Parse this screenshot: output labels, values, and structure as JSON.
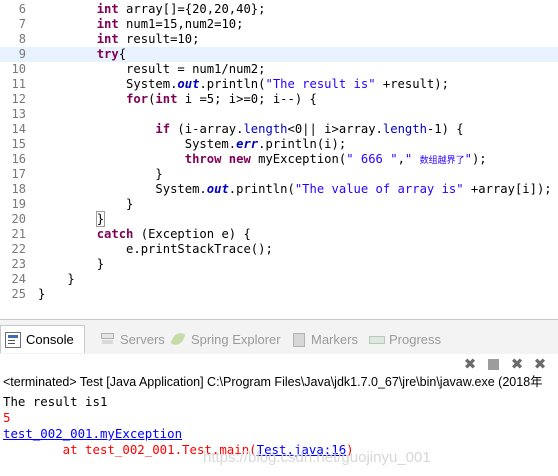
{
  "editor": {
    "lines": [
      {
        "n": "6",
        "parts": [
          [
            "p",
            "        "
          ],
          [
            "k",
            "int"
          ],
          [
            "p",
            " array[]={20,20,40};"
          ]
        ]
      },
      {
        "n": "7",
        "parts": [
          [
            "p",
            "        "
          ],
          [
            "k",
            "int"
          ],
          [
            "p",
            " num1=15,num2=10;"
          ]
        ]
      },
      {
        "n": "8",
        "parts": [
          [
            "p",
            "        "
          ],
          [
            "k",
            "int"
          ],
          [
            "p",
            " result=10;"
          ]
        ]
      },
      {
        "n": "9",
        "parts": [
          [
            "p",
            "        "
          ],
          [
            "k",
            "try"
          ],
          [
            "p",
            "{"
          ]
        ],
        "highlight": true
      },
      {
        "n": "10",
        "parts": [
          [
            "p",
            "            result = num1/num2;"
          ]
        ]
      },
      {
        "n": "11",
        "parts": [
          [
            "p",
            "            System."
          ],
          [
            "f",
            "out"
          ],
          [
            "p",
            ".println("
          ],
          [
            "s",
            "\"The result is\""
          ],
          [
            "p",
            " +result);"
          ]
        ]
      },
      {
        "n": "12",
        "parts": [
          [
            "p",
            "            "
          ],
          [
            "k",
            "for"
          ],
          [
            "p",
            "("
          ],
          [
            "k",
            "int"
          ],
          [
            "p",
            " i =5; i>=0; i--) {"
          ]
        ]
      },
      {
        "n": "13",
        "parts": [
          [
            "p",
            ""
          ]
        ]
      },
      {
        "n": "14",
        "parts": [
          [
            "p",
            "                "
          ],
          [
            "k",
            "if"
          ],
          [
            "p",
            " (i-array."
          ],
          [
            "fp",
            "length"
          ],
          [
            "p",
            "<0|| i>array."
          ],
          [
            "fp",
            "length"
          ],
          [
            "p",
            "-1) {"
          ]
        ]
      },
      {
        "n": "15",
        "parts": [
          [
            "p",
            "                    System."
          ],
          [
            "f",
            "err"
          ],
          [
            "p",
            ".println(i);"
          ]
        ]
      },
      {
        "n": "16",
        "parts": [
          [
            "p",
            "                    "
          ],
          [
            "k",
            "throw"
          ],
          [
            "p",
            " "
          ],
          [
            "k",
            "new"
          ],
          [
            "p",
            " myException("
          ],
          [
            "s",
            "\" 666 \""
          ],
          [
            "p",
            ","
          ],
          [
            "s",
            "\" "
          ],
          [
            "cjk",
            "数组越界了"
          ],
          [
            "s",
            "\""
          ],
          [
            "p",
            ");"
          ]
        ]
      },
      {
        "n": "17",
        "parts": [
          [
            "p",
            "                }"
          ]
        ]
      },
      {
        "n": "18",
        "parts": [
          [
            "p",
            "                System."
          ],
          [
            "f",
            "out"
          ],
          [
            "p",
            ".println("
          ],
          [
            "s",
            "\"The value of array is\""
          ],
          [
            "p",
            " +array[i]);"
          ]
        ]
      },
      {
        "n": "19",
        "parts": [
          [
            "p",
            "            }"
          ]
        ]
      },
      {
        "n": "20",
        "parts": [
          [
            "p",
            "        "
          ],
          [
            "box",
            "}"
          ]
        ]
      },
      {
        "n": "21",
        "parts": [
          [
            "p",
            "        "
          ],
          [
            "k",
            "catch"
          ],
          [
            "p",
            " (Exception e) {"
          ]
        ]
      },
      {
        "n": "22",
        "parts": [
          [
            "p",
            "            e.printStackTrace();"
          ]
        ]
      },
      {
        "n": "23",
        "parts": [
          [
            "p",
            "        }"
          ]
        ]
      },
      {
        "n": "24",
        "parts": [
          [
            "p",
            "    }"
          ]
        ]
      },
      {
        "n": "25",
        "parts": [
          [
            "p",
            "}"
          ]
        ]
      }
    ]
  },
  "tabs": {
    "console": "Console",
    "servers": "Servers",
    "spring": "Spring Explorer",
    "markers": "Markers",
    "progress": "Progress"
  },
  "toolbar": {
    "remove_launch": "✖",
    "terminate": "■",
    "remove_all": "✖",
    "clear": "✖"
  },
  "console": {
    "terminated": "<terminated> Test [Java Application] C:\\Program Files\\Java\\jdk1.7.0_67\\jre\\bin\\javaw.exe (2018年",
    "line1": "The result is1",
    "line2": "5",
    "line3": "test_002_001.myException",
    "line4_prefix": "        at test_002_001.Test.main(",
    "line4_link": "Test.java:16",
    "line4_suffix": ")"
  },
  "watermark": "https://blog.csdn.net/guojinyu_001"
}
